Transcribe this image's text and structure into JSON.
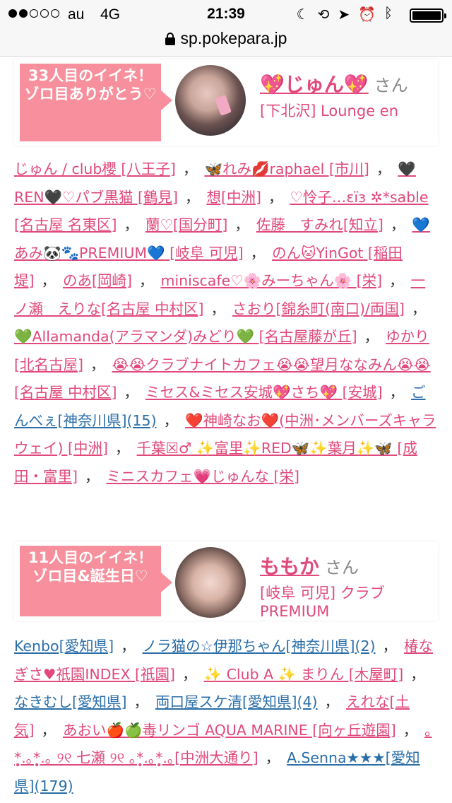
{
  "status_bar": {
    "signal_dots_filled": 2,
    "signal_dots_total": 5,
    "carrier": "au",
    "network": "4G",
    "time": "21:39",
    "icons": [
      "moon-icon",
      "rotation-lock-icon",
      "location-icon",
      "alarm-icon",
      "bluetooth-icon",
      "battery-icon"
    ]
  },
  "url_bar": {
    "url": "sp.pokepara.jp"
  },
  "cards": [
    {
      "badge": "33人目のイイネ！ゾロ目ありがとう♡",
      "girl_name": "💖じゅん💖",
      "suffix": "さん",
      "shop": "[下北沢] Lounge en",
      "likes": [
        {
          "text": "じゅん / club櫻 [八王子]",
          "color": "pink"
        },
        {
          "text": "🦋れみ💋raphael [市川]",
          "color": "pink"
        },
        {
          "text": "🖤REN🖤♡パブ黒猫 [鶴見]",
          "color": "pink"
        },
        {
          "text": "想[中洲]",
          "color": "pink"
        },
        {
          "text": "♡怜子…ɛïɜ ✲*sable [名古屋 名東区]",
          "color": "pink"
        },
        {
          "text": "蘭♡[国分町]",
          "color": "pink"
        },
        {
          "text": "佐藤　すみれ[知立]",
          "color": "pink"
        },
        {
          "text": "💙あみ🐼🐾PREMIUM💙 [岐阜 可児]",
          "color": "pink"
        },
        {
          "text": "のん🐱YinGot [稲田堤]",
          "color": "pink"
        },
        {
          "text": "のあ[岡崎]",
          "color": "pink"
        },
        {
          "text": "miniscafe♡🌸みーちゃん🌸 [栄]",
          "color": "pink"
        },
        {
          "text": "一ノ瀬　えりな[名古屋 中村区]",
          "color": "pink"
        },
        {
          "text": "さおり[錦糸町(南口)/両国]",
          "color": "pink"
        },
        {
          "text": "💚Allamanda(アラマンダ)みどり💚 [名古屋藤が丘]",
          "color": "pink"
        },
        {
          "text": "ゆかり[北名古屋]",
          "color": "pink"
        },
        {
          "text": "😭😭クラブナイトカフェ😭😭望月ななみん😭😭 [名古屋 中村区]",
          "color": "pink"
        },
        {
          "text": "ミセス&ミセス安城💖さち💖 [安城]",
          "color": "pink"
        },
        {
          "text": "ごんべぇ[神奈川県](15)",
          "color": "blue"
        },
        {
          "text": "❤️神崎なお❤️(中洲･メンバーズキャラウェイ) [中洲]",
          "color": "pink"
        },
        {
          "text": "千葉☒♂ ✨富里✨RED🦋✨葉月✨🦋 [成田・富里]",
          "color": "pink"
        },
        {
          "text": "ミニスカフェ💗じゅんな [栄]",
          "color": "pink"
        }
      ]
    },
    {
      "badge": "11人目のイイネ！ゾロ目&誕生日♡",
      "girl_name": "ももか",
      "suffix": "さん",
      "shop": "[岐阜 可児] クラブPREMIUM",
      "likes": [
        {
          "text": "Kenbo[愛知県]",
          "color": "blue"
        },
        {
          "text": "ノラ猫の☆伊那ちゃん[神奈川県](2)",
          "color": "blue"
        },
        {
          "text": "椿なぎさ♥祇園INDEX [祇園]",
          "color": "pink"
        },
        {
          "text": "✨ Club A ✨ まりん [木屋町]",
          "color": "pink"
        },
        {
          "text": "なきむし[愛知県]",
          "color": "blue"
        },
        {
          "text": "両口屋スケ清[愛知県](4)",
          "color": "blue"
        },
        {
          "text": "えれな[土気]",
          "color": "pink"
        },
        {
          "text": "あおい🍎🍏毒リンゴ AQUA MARINE [向ヶ丘遊園]",
          "color": "pink"
        },
        {
          "text": "｡*̩̩̥.｡*̩̩̥.｡ ୨୧ 七瀬 ୨୧ ｡*̩̩̥.｡*̩̩̥.｡[中洲大通り]",
          "color": "pink"
        },
        {
          "text": "A.Senna★★★[愛知県](179)",
          "color": "blue"
        }
      ]
    }
  ]
}
